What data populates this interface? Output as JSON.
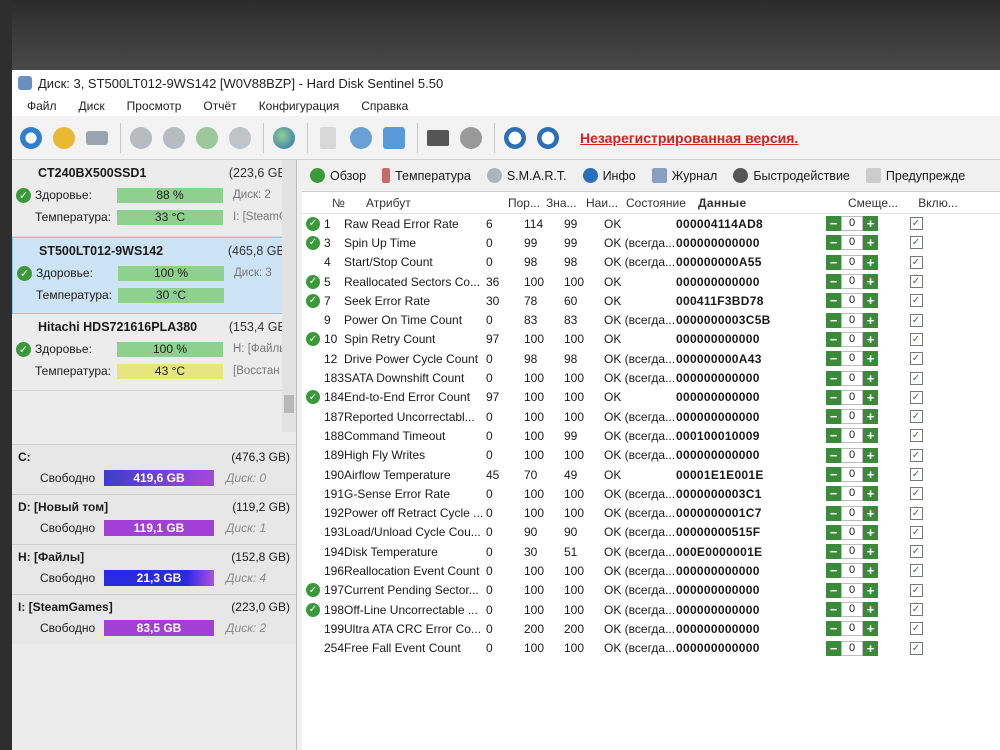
{
  "window": {
    "title": "Диск: 3, ST500LT012-9WS142 [W0V88BZP]  -  Hard Disk Sentinel 5.50"
  },
  "menu": [
    "Файл",
    "Диск",
    "Просмотр",
    "Отчёт",
    "Конфигурация",
    "Справка"
  ],
  "toolbar": {
    "unregistered": "Незарегистрированная версия."
  },
  "disks": [
    {
      "name": "CT240BX500SSD1",
      "capacity": "(223,6 GB)",
      "health_label": "Здоровье:",
      "health": "88 %",
      "health_extra": "Диск: 2",
      "temp_label": "Температура:",
      "temp": "33 °C",
      "temp_extra": "I: [SteamG",
      "selected": false,
      "temp_warm": false
    },
    {
      "name": "ST500LT012-9WS142",
      "capacity": "(465,8 GB)",
      "health_label": "Здоровье:",
      "health": "100 %",
      "health_extra": "Диск: 3",
      "temp_label": "Температура:",
      "temp": "30 °C",
      "temp_extra": "",
      "selected": true,
      "temp_warm": false
    },
    {
      "name": "Hitachi HDS721616PLA380",
      "capacity": "(153,4 GB)",
      "health_label": "Здоровье:",
      "health": "100 %",
      "health_extra": "H: [Файлы",
      "temp_label": "Температура:",
      "temp": "43 °C",
      "temp_extra": "[Восстан",
      "selected": false,
      "temp_warm": true
    }
  ],
  "partitions": [
    {
      "name": "C:",
      "capacity": "(476,3 GB)",
      "free_label": "Свободно",
      "free": "419,6 GB",
      "disk": "Диск: 0",
      "bar": "grad"
    },
    {
      "name": "D: [Новый том]",
      "capacity": "(119,2 GB)",
      "free_label": "Свободно",
      "free": "119,1 GB",
      "disk": "Диск: 1",
      "bar": "purple"
    },
    {
      "name": "H: [Файлы]",
      "capacity": "(152,8 GB)",
      "free_label": "Свободно",
      "free": "21,3 GB",
      "disk": "Диск: 4",
      "bar": "blue"
    },
    {
      "name": "I: [SteamGames]",
      "capacity": "(223,0 GB)",
      "free_label": "Свободно",
      "free": "83,5 GB",
      "disk": "Диск: 2",
      "bar": "purple"
    }
  ],
  "tabs": [
    "Обзор",
    "Температура",
    "S.M.A.R.T.",
    "Инфо",
    "Журнал",
    "Быстродействие",
    "Предупрежде"
  ],
  "columns": {
    "no": "№",
    "attr": "Атрибут",
    "thr": "Пор...",
    "val": "Зна...",
    "wst": "Наи...",
    "status": "Состояние",
    "data": "Данные",
    "offset": "Смеще...",
    "enabled": "Вклю..."
  },
  "smart": [
    {
      "ok": true,
      "no": "1",
      "attr": "Raw Read Error Rate",
      "thr": "6",
      "val": "114",
      "wst": "99",
      "status": "OK",
      "data": "000004114AD8"
    },
    {
      "ok": true,
      "no": "3",
      "attr": "Spin Up Time",
      "thr": "0",
      "val": "99",
      "wst": "99",
      "status": "OK (всегда...",
      "data": "000000000000"
    },
    {
      "ok": false,
      "no": "4",
      "attr": "Start/Stop Count",
      "thr": "0",
      "val": "98",
      "wst": "98",
      "status": "OK (всегда...",
      "data": "000000000A55"
    },
    {
      "ok": true,
      "no": "5",
      "attr": "Reallocated Sectors Co...",
      "thr": "36",
      "val": "100",
      "wst": "100",
      "status": "OK",
      "data": "000000000000"
    },
    {
      "ok": true,
      "no": "7",
      "attr": "Seek Error Rate",
      "thr": "30",
      "val": "78",
      "wst": "60",
      "status": "OK",
      "data": "000411F3BD78"
    },
    {
      "ok": false,
      "no": "9",
      "attr": "Power On Time Count",
      "thr": "0",
      "val": "83",
      "wst": "83",
      "status": "OK (всегда...",
      "data": "0000000003C5B"
    },
    {
      "ok": true,
      "no": "10",
      "attr": "Spin Retry Count",
      "thr": "97",
      "val": "100",
      "wst": "100",
      "status": "OK",
      "data": "000000000000"
    },
    {
      "ok": false,
      "no": "12",
      "attr": "Drive Power Cycle Count",
      "thr": "0",
      "val": "98",
      "wst": "98",
      "status": "OK (всегда...",
      "data": "000000000A43"
    },
    {
      "ok": false,
      "no": "183",
      "attr": "SATA Downshift Count",
      "thr": "0",
      "val": "100",
      "wst": "100",
      "status": "OK (всегда...",
      "data": "000000000000"
    },
    {
      "ok": true,
      "no": "184",
      "attr": "End-to-End Error Count",
      "thr": "97",
      "val": "100",
      "wst": "100",
      "status": "OK",
      "data": "000000000000"
    },
    {
      "ok": false,
      "no": "187",
      "attr": "Reported Uncorrectabl...",
      "thr": "0",
      "val": "100",
      "wst": "100",
      "status": "OK (всегда...",
      "data": "000000000000"
    },
    {
      "ok": false,
      "no": "188",
      "attr": "Command Timeout",
      "thr": "0",
      "val": "100",
      "wst": "99",
      "status": "OK (всегда...",
      "data": "000100010009"
    },
    {
      "ok": false,
      "no": "189",
      "attr": "High Fly Writes",
      "thr": "0",
      "val": "100",
      "wst": "100",
      "status": "OK (всегда...",
      "data": "000000000000"
    },
    {
      "ok": false,
      "no": "190",
      "attr": "Airflow Temperature",
      "thr": "45",
      "val": "70",
      "wst": "49",
      "status": "OK",
      "data": "00001E1E001E"
    },
    {
      "ok": false,
      "no": "191",
      "attr": "G-Sense Error Rate",
      "thr": "0",
      "val": "100",
      "wst": "100",
      "status": "OK (всегда...",
      "data": "0000000003C1"
    },
    {
      "ok": false,
      "no": "192",
      "attr": "Power off Retract Cycle ...",
      "thr": "0",
      "val": "100",
      "wst": "100",
      "status": "OK (всегда...",
      "data": "0000000001C7"
    },
    {
      "ok": false,
      "no": "193",
      "attr": "Load/Unload Cycle Cou...",
      "thr": "0",
      "val": "90",
      "wst": "90",
      "status": "OK (всегда...",
      "data": "00000000515F"
    },
    {
      "ok": false,
      "no": "194",
      "attr": "Disk Temperature",
      "thr": "0",
      "val": "30",
      "wst": "51",
      "status": "OK (всегда...",
      "data": "000E0000001E"
    },
    {
      "ok": false,
      "no": "196",
      "attr": "Reallocation Event Count",
      "thr": "0",
      "val": "100",
      "wst": "100",
      "status": "OK (всегда...",
      "data": "000000000000"
    },
    {
      "ok": true,
      "no": "197",
      "attr": "Current Pending Sector...",
      "thr": "0",
      "val": "100",
      "wst": "100",
      "status": "OK (всегда...",
      "data": "000000000000"
    },
    {
      "ok": true,
      "no": "198",
      "attr": "Off-Line Uncorrectable ...",
      "thr": "0",
      "val": "100",
      "wst": "100",
      "status": "OK (всегда...",
      "data": "000000000000"
    },
    {
      "ok": false,
      "no": "199",
      "attr": "Ultra ATA CRC Error Co...",
      "thr": "0",
      "val": "200",
      "wst": "200",
      "status": "OK (всегда...",
      "data": "000000000000"
    },
    {
      "ok": false,
      "no": "254",
      "attr": "Free Fall Event Count",
      "thr": "0",
      "val": "100",
      "wst": "100",
      "status": "OK (всегда...",
      "data": "000000000000"
    }
  ],
  "offset_value": "0",
  "colors": {
    "health_bar": "#8ed08e",
    "warm_bar": "#e6e680",
    "unregistered": "#d02020",
    "ok_icon": "#3a9a3a"
  }
}
